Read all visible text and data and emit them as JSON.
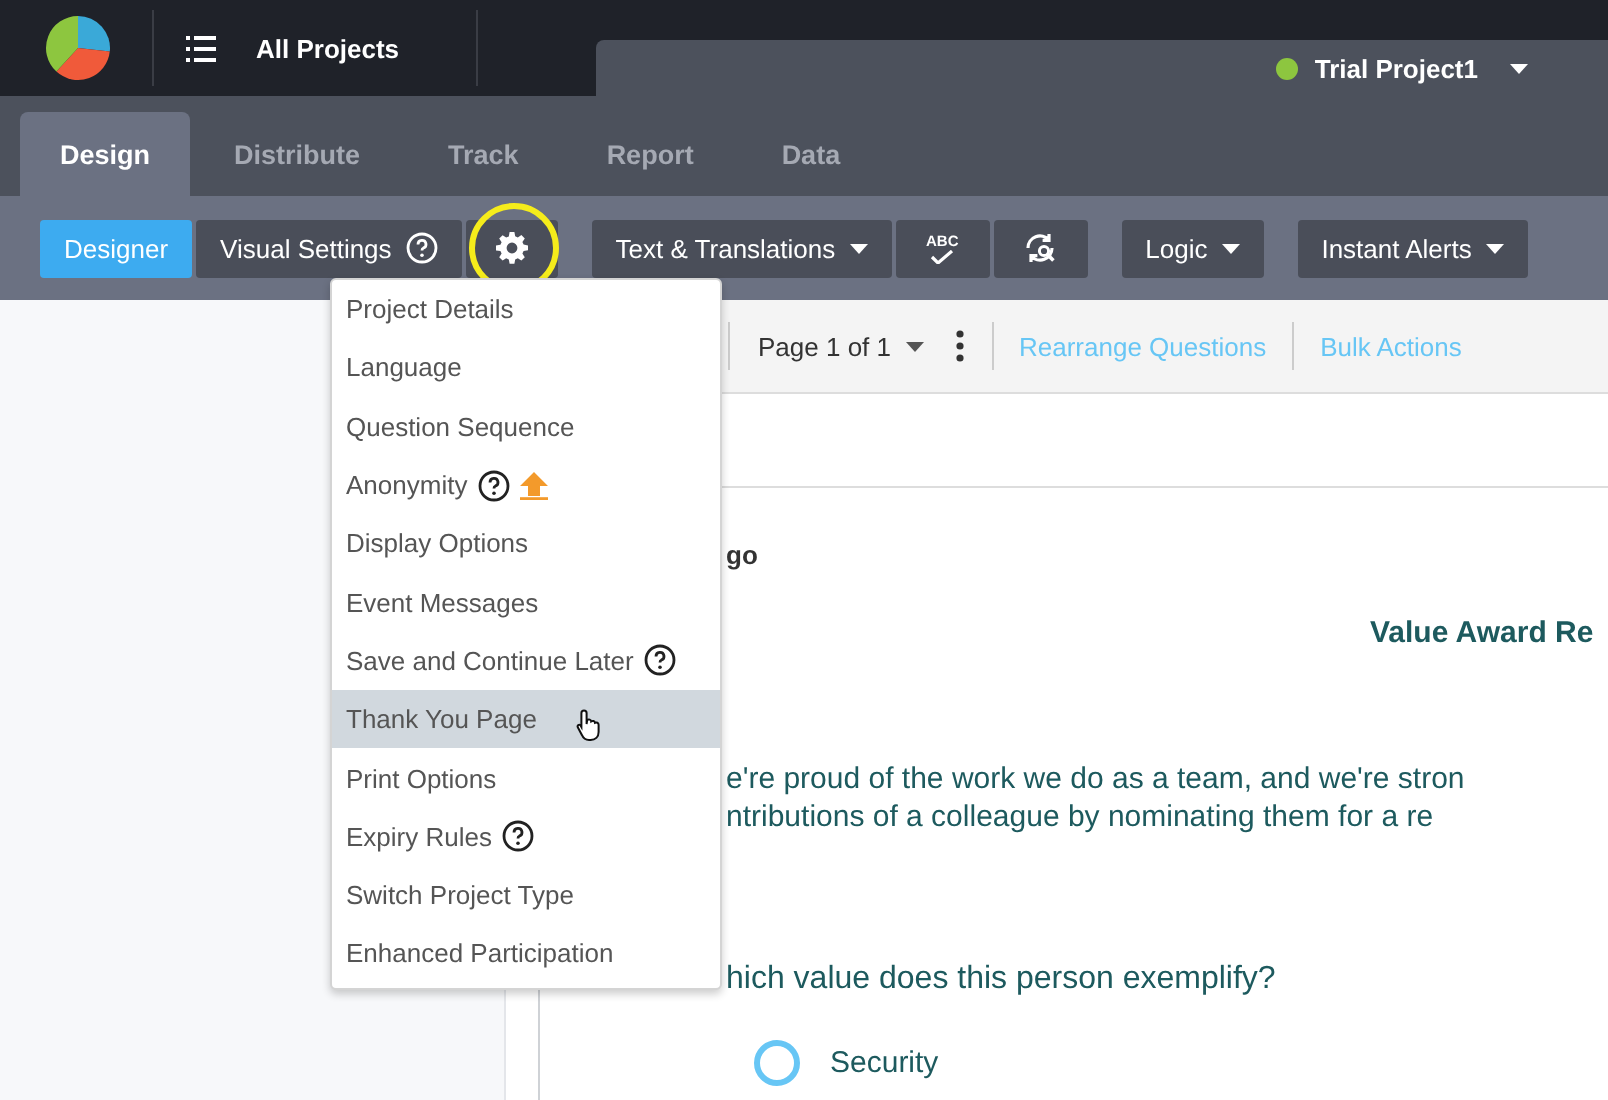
{
  "header": {
    "title": "All Projects",
    "project": {
      "name": "Trial Project1",
      "color": "#8dc63f"
    }
  },
  "tabs": [
    {
      "label": "Design",
      "selected": true
    },
    {
      "label": "Distribute",
      "selected": false
    },
    {
      "label": "Track",
      "selected": false
    },
    {
      "label": "Report",
      "selected": false
    },
    {
      "label": "Data",
      "selected": false
    }
  ],
  "toolbar": {
    "groups": [
      [
        {
          "kind": "toggle",
          "label": "Designer",
          "selected": true,
          "help": false
        },
        {
          "kind": "toggle",
          "label": "Visual Settings",
          "selected": false,
          "help": true
        },
        {
          "kind": "gear",
          "highlighted": true
        }
      ],
      [
        {
          "kind": "dropdown",
          "label": "Text & Translations"
        },
        {
          "kind": "spell",
          "label": "ABC"
        },
        {
          "kind": "refresh"
        }
      ],
      [
        {
          "kind": "dropdown",
          "label": "Logic"
        }
      ],
      [
        {
          "kind": "dropdown",
          "label": "Instant Alerts"
        }
      ]
    ]
  },
  "settings_menu": [
    {
      "label": "Project Details",
      "help": false,
      "upgrade": false,
      "selected": false
    },
    {
      "label": "Language",
      "help": false,
      "upgrade": false,
      "selected": false
    },
    {
      "label": "Question Sequence",
      "help": false,
      "upgrade": false,
      "selected": false
    },
    {
      "label": "Anonymity",
      "help": true,
      "upgrade": true,
      "selected": false
    },
    {
      "label": "Display Options",
      "help": false,
      "upgrade": false,
      "selected": false
    },
    {
      "label": "Event Messages",
      "help": false,
      "upgrade": false,
      "selected": false
    },
    {
      "label": "Save and Continue Later",
      "help": true,
      "upgrade": false,
      "selected": false
    },
    {
      "label": "Thank You Page",
      "help": false,
      "upgrade": false,
      "selected": true
    },
    {
      "label": "Print Options",
      "help": false,
      "upgrade": false,
      "selected": false
    },
    {
      "label": "Expiry Rules",
      "help": true,
      "upgrade": false,
      "selected": false
    },
    {
      "label": "Switch Project Type",
      "help": false,
      "upgrade": false,
      "selected": false
    },
    {
      "label": "Enhanced Participation",
      "help": false,
      "upgrade": false,
      "selected": false
    }
  ],
  "page_bar": {
    "page": "Page 1 of 1",
    "links": [
      "Rearrange Questions",
      "Bulk Actions"
    ]
  },
  "survey": {
    "logo_text": "go",
    "title": "Value Award Re",
    "intro": [
      "e're proud of the work we do as a team, and we're stron",
      "ntributions of a colleague by nominating them for a re"
    ],
    "question": "hich value does this person exemplify?",
    "options": [
      {
        "label": "Security",
        "selected": false
      }
    ]
  }
}
